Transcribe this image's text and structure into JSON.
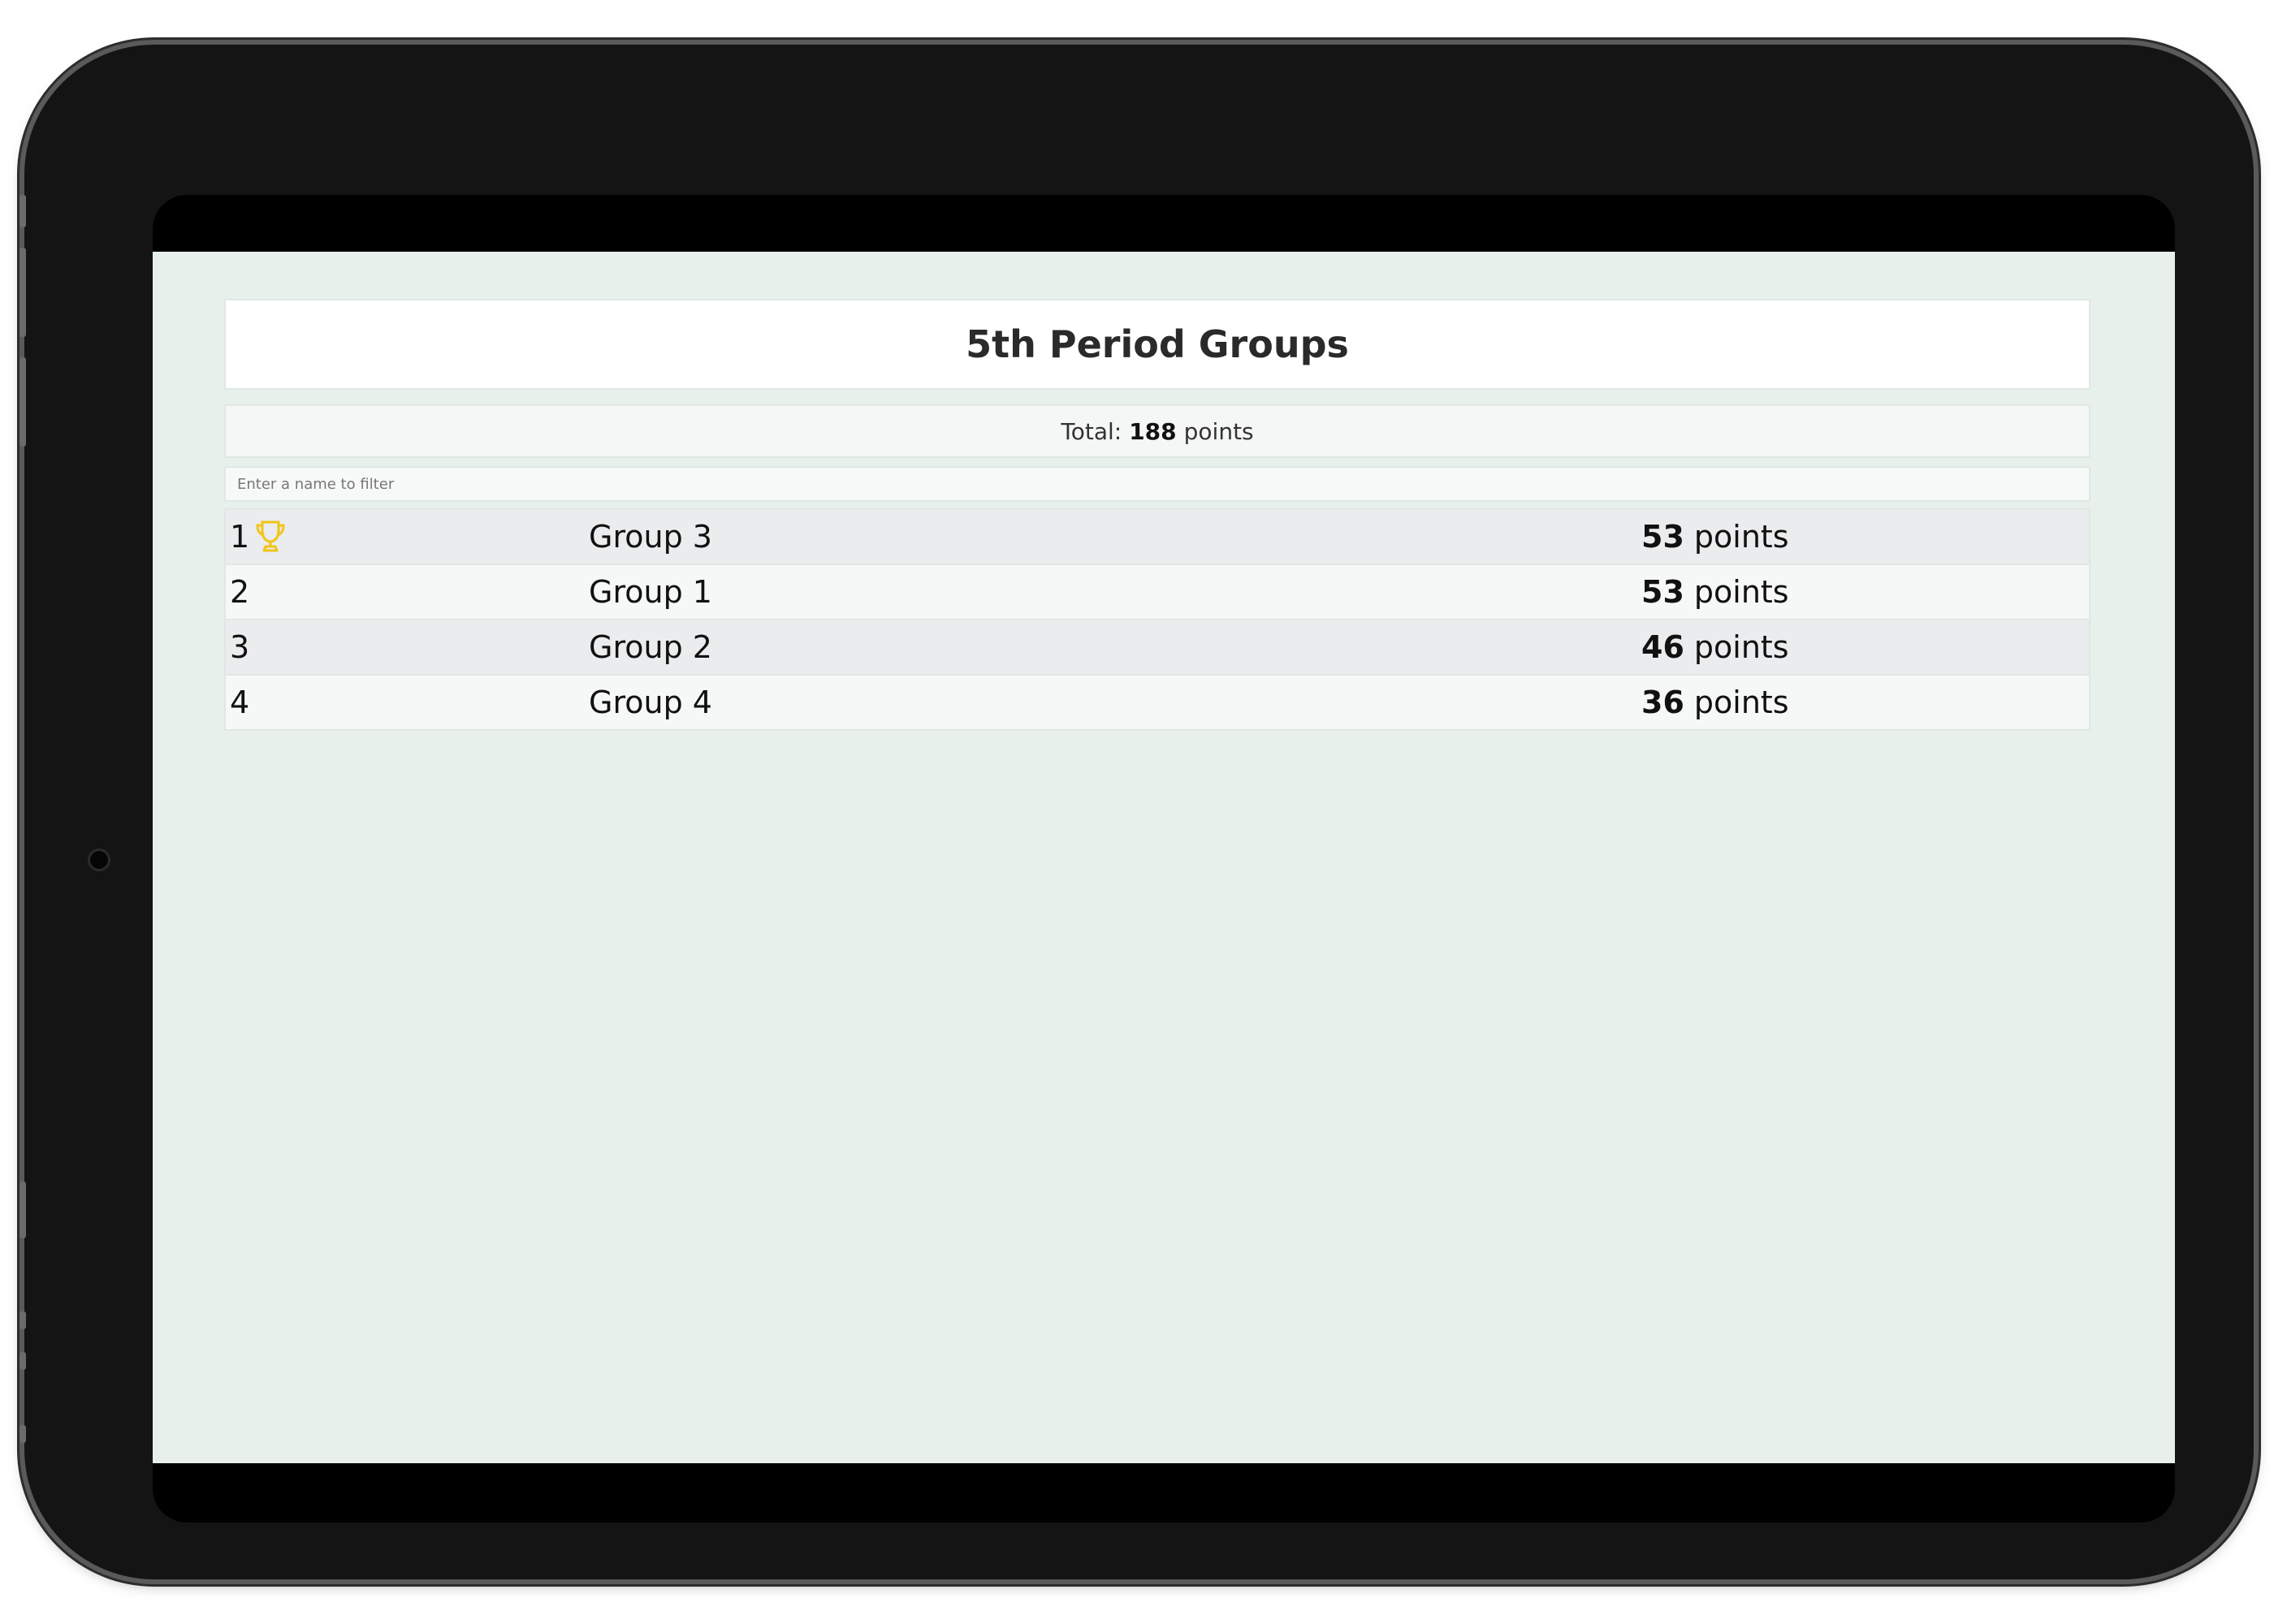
{
  "page": {
    "title": "5th Period Groups",
    "total_label": "Total:",
    "total_value": "188",
    "total_unit": "points",
    "filter_placeholder": "Enter a name to filter",
    "filter_value": ""
  },
  "leaderboard": [
    {
      "rank": "1",
      "name": "Group 3",
      "points": "53",
      "unit": "points",
      "icon": "trophy-icon"
    },
    {
      "rank": "2",
      "name": "Group 1",
      "points": "53",
      "unit": "points"
    },
    {
      "rank": "3",
      "name": "Group 2",
      "points": "46",
      "unit": "points"
    },
    {
      "rank": "4",
      "name": "Group 4",
      "points": "36",
      "unit": "points"
    }
  ],
  "colors": {
    "screen_background": "#e8f0eb",
    "trophy": "#f2c319"
  }
}
